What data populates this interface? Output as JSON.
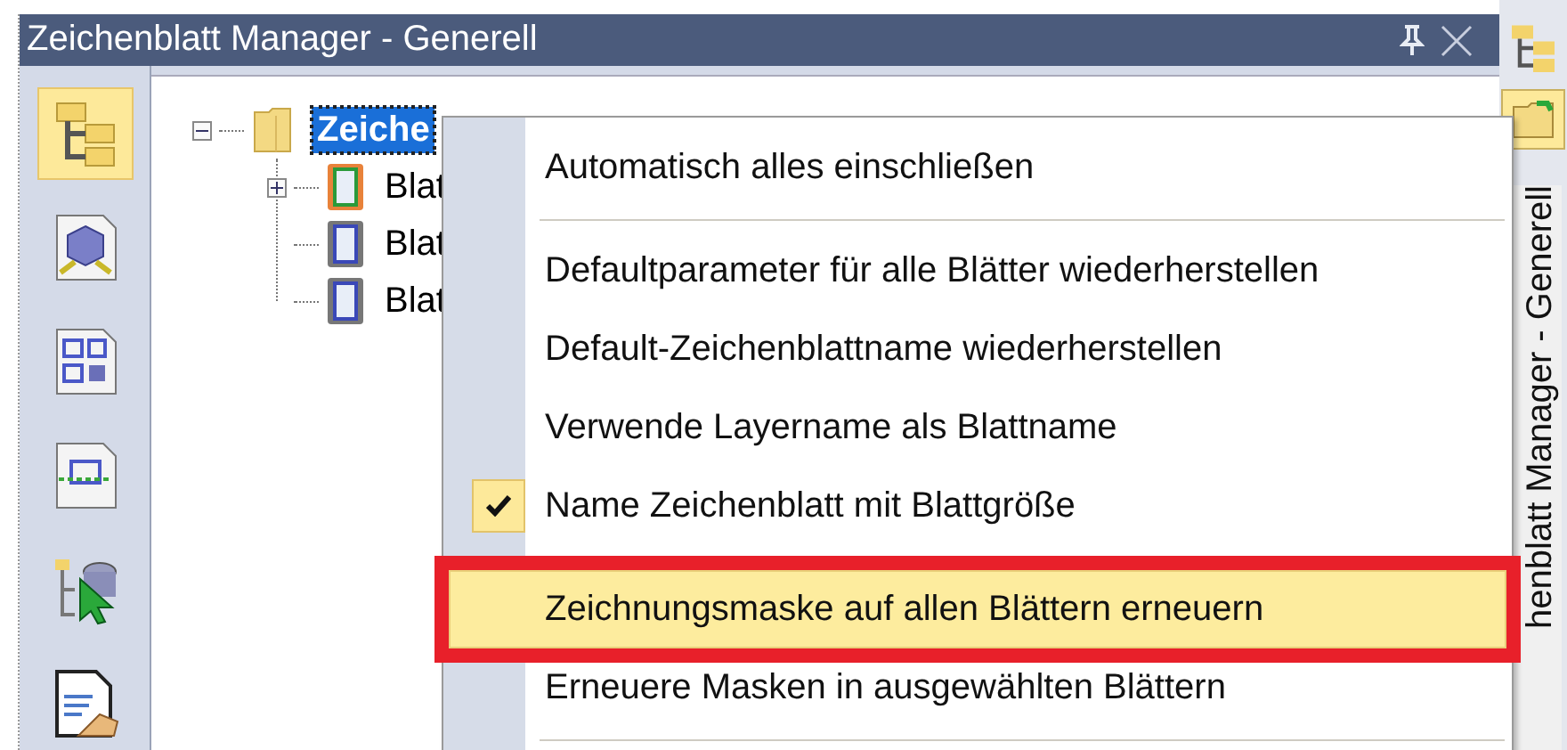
{
  "panel": {
    "title": "Zeichenblatt Manager - Generell"
  },
  "toolbar": {
    "items": [
      {
        "kind": "tree",
        "selected": true
      },
      {
        "kind": "cube",
        "selected": false
      },
      {
        "kind": "layout",
        "selected": false
      },
      {
        "kind": "frame",
        "selected": false
      },
      {
        "kind": "pointer",
        "selected": false
      },
      {
        "kind": "document",
        "selected": false
      }
    ]
  },
  "tree": {
    "root": {
      "label": "Zeiche",
      "selected": true,
      "expanded": true,
      "children": [
        {
          "kind": "group",
          "label": "Blat",
          "current": true
        },
        {
          "kind": "sheet",
          "label": "Blat",
          "current": false
        },
        {
          "kind": "sheet",
          "label": "Blat",
          "current": false
        }
      ]
    }
  },
  "context_menu": {
    "items": [
      {
        "kind": "item",
        "label": "Automatisch alles einschließen",
        "checked": false,
        "selected": false,
        "annotated": false
      },
      {
        "kind": "separator"
      },
      {
        "kind": "item",
        "label": "Defaultparameter für alle Blätter wiederherstellen",
        "checked": false,
        "selected": false,
        "annotated": false
      },
      {
        "kind": "item",
        "label": "Default-Zeichenblattname wiederherstellen",
        "checked": false,
        "selected": false,
        "annotated": false
      },
      {
        "kind": "item",
        "label": "Verwende Layername als Blattname",
        "checked": false,
        "selected": false,
        "annotated": false
      },
      {
        "kind": "item",
        "label": "Name Zeichenblatt mit Blattgröße",
        "checked": true,
        "selected": false,
        "annotated": false
      },
      {
        "kind": "item",
        "label": "Zeichnungsmaske auf allen Blättern erneuern",
        "checked": false,
        "selected": true,
        "annotated": true
      },
      {
        "kind": "item",
        "label": "Erneuere Masken in ausgewählten Blättern",
        "checked": false,
        "selected": false,
        "annotated": false
      },
      {
        "kind": "separator"
      }
    ]
  },
  "side_tab": {
    "label": "henblatt Manager - Generell"
  }
}
